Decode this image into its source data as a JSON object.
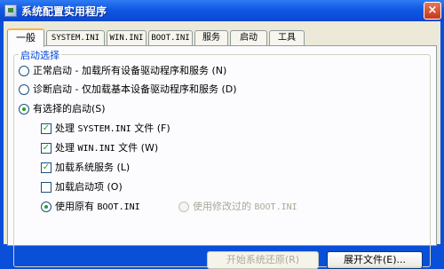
{
  "window": {
    "title": "系统配置实用程序",
    "close_label": "×"
  },
  "tabs": [
    {
      "label": "一般"
    },
    {
      "label": "SYSTEM.INI"
    },
    {
      "label": "WIN.INI"
    },
    {
      "label": "BOOT.INI"
    },
    {
      "label": "服务"
    },
    {
      "label": "启动"
    },
    {
      "label": "工具"
    }
  ],
  "startup_group": {
    "legend": "启动选择",
    "normal_label": "正常启动 - 加载所有设备驱动程序和服务 (N)",
    "diagnostic_label": "诊断启动 - 仅加载基本设备驱动程序和服务 (D)",
    "selective_label": "有选择的启动(S)",
    "selected": "selective",
    "options": [
      {
        "prefix": "处理 ",
        "mono": "SYSTEM.INI",
        "suffix": " 文件 (F)",
        "checked": true
      },
      {
        "prefix": "处理 ",
        "mono": "WIN.INI",
        "suffix": " 文件 (W)",
        "checked": true
      },
      {
        "prefix": "加载系统服务 (L)",
        "mono": "",
        "suffix": "",
        "checked": true
      },
      {
        "prefix": "加载启动项 (O)",
        "mono": "",
        "suffix": "",
        "checked": false
      }
    ],
    "boot_original_prefix": "使用原有 ",
    "boot_original_mono": "BOOT.INI",
    "boot_modified_prefix": "使用修改过的 ",
    "boot_modified_mono": "BOOT.INI",
    "boot_selected": "original"
  },
  "buttons": {
    "restore_label": "开始系统还原(R)",
    "expand_label": "展开文件(E)..."
  },
  "check_glyph": "✓"
}
